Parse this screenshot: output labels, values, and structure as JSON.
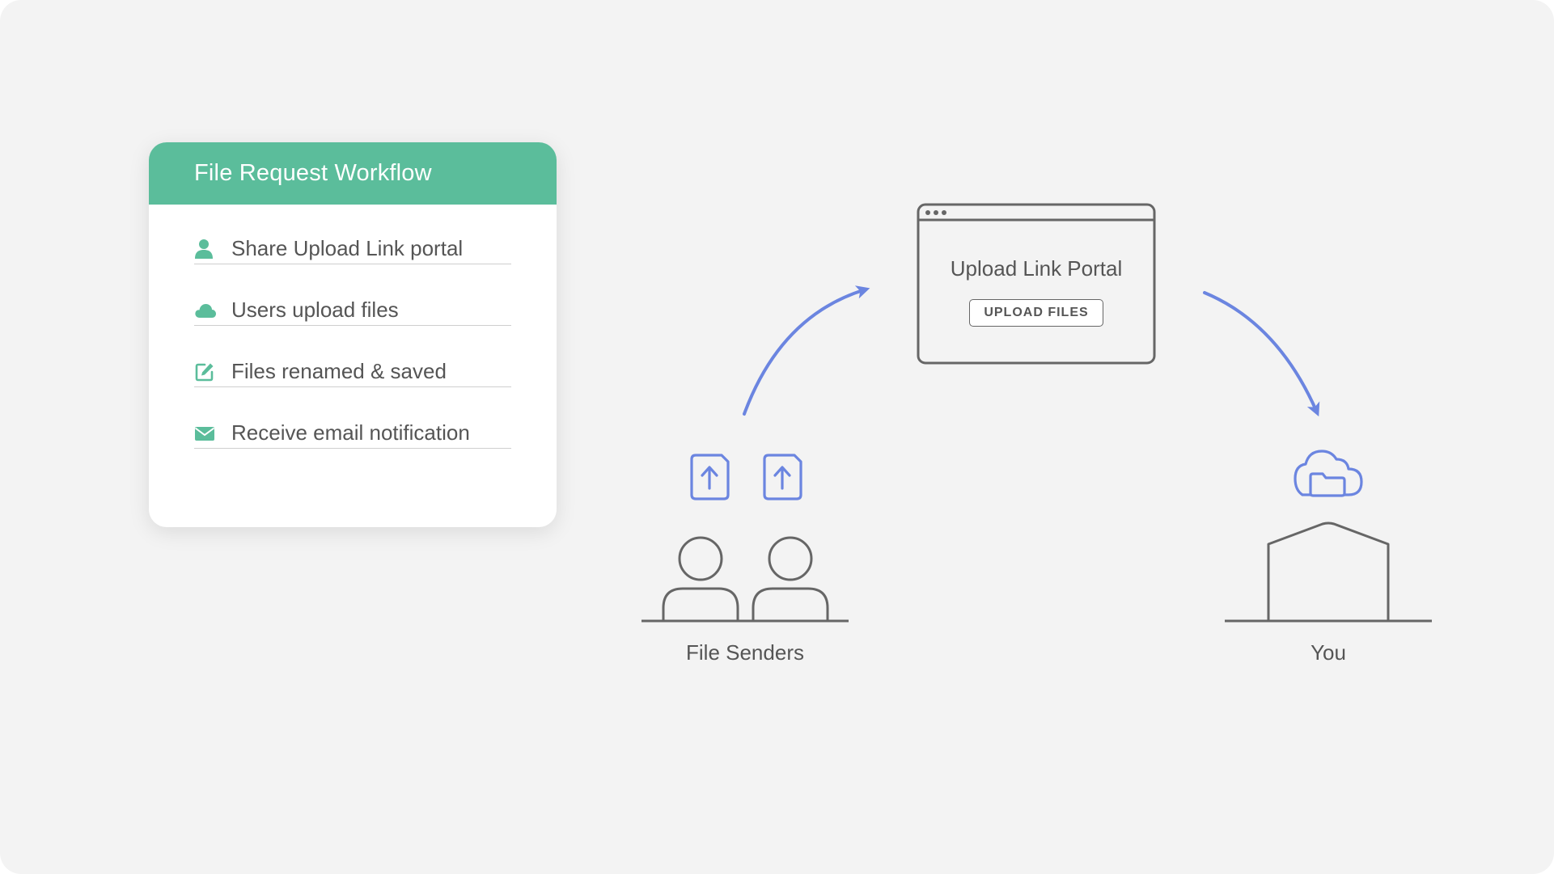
{
  "card": {
    "title": "File Request Workflow",
    "accent_color": "#5bbd9b",
    "items": [
      {
        "icon": "user-icon",
        "label": "Share Upload Link portal"
      },
      {
        "icon": "cloud-icon",
        "label": "Users upload files"
      },
      {
        "icon": "edit-icon",
        "label": "Files renamed & saved"
      },
      {
        "icon": "envelope-icon",
        "label": "Receive email notification"
      }
    ]
  },
  "diagram": {
    "portal": {
      "title": "Upload Link Portal",
      "button_label": "UPLOAD FILES"
    },
    "senders_label": "File Senders",
    "recipient_label": "You",
    "arrow_color": "#6b85e0",
    "icons": [
      "file-upload-icon",
      "file-upload-icon",
      "person-icon",
      "person-icon",
      "browser-window-icon",
      "cloud-folder-icon",
      "building-icon"
    ]
  }
}
